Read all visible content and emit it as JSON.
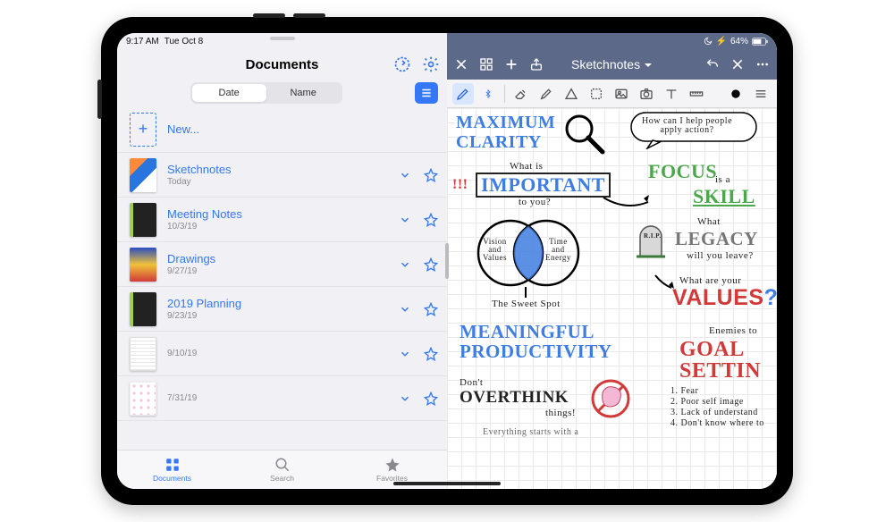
{
  "status": {
    "time": "9:17 AM",
    "date": "Tue Oct 8",
    "battery_text": "64%"
  },
  "left": {
    "title": "Documents",
    "segments": {
      "date": "Date",
      "name": "Name"
    },
    "new_label": "New...",
    "items": [
      {
        "title": "Sketchnotes",
        "sub": "Today"
      },
      {
        "title": "Meeting Notes",
        "sub": "10/3/19"
      },
      {
        "title": "Drawings",
        "sub": "9/27/19"
      },
      {
        "title": "2019 Planning",
        "sub": "9/23/19"
      },
      {
        "title": "",
        "sub": "9/10/19"
      },
      {
        "title": "",
        "sub": "7/31/19"
      }
    ],
    "tabs": {
      "documents": "Documents",
      "search": "Search",
      "favorites": "Favorites"
    }
  },
  "right": {
    "title": "Sketchnotes",
    "sketch": {
      "max_clarity_1": "MAXIMUM",
      "max_clarity_2": "CLARITY",
      "bubble": "How can I help people\napply action?",
      "what_is": "What is",
      "important": "IMPORTANT",
      "to_you": "to you?",
      "excl": "!!!",
      "focus": "FOCUS",
      "is_a": "is a",
      "skill": "SKILL",
      "venn_left": "Vision\nand\nValues",
      "venn_right": "Time\nand\nEnergy",
      "sweet_spot": "The Sweet Spot",
      "what": "What",
      "legacy": "LEGACY",
      "will_you": "will you leave?",
      "what_are": "What are your",
      "values": "VALUES",
      "meaningful": "MEANINGFUL",
      "productivity": "PRODUCTIVITY",
      "enemies": "Enemies to",
      "goal": "GOAL",
      "setting": "SETTIN",
      "dont": "Don't",
      "overthink": "OVERTHINK",
      "things": "things!",
      "rip": "R.I.P.",
      "list1": "1. Fear",
      "list2": "2. Poor self image",
      "list3": "3. Lack of understand",
      "list4": "4. Don't know where to",
      "footer": "Everything starts with a"
    }
  }
}
